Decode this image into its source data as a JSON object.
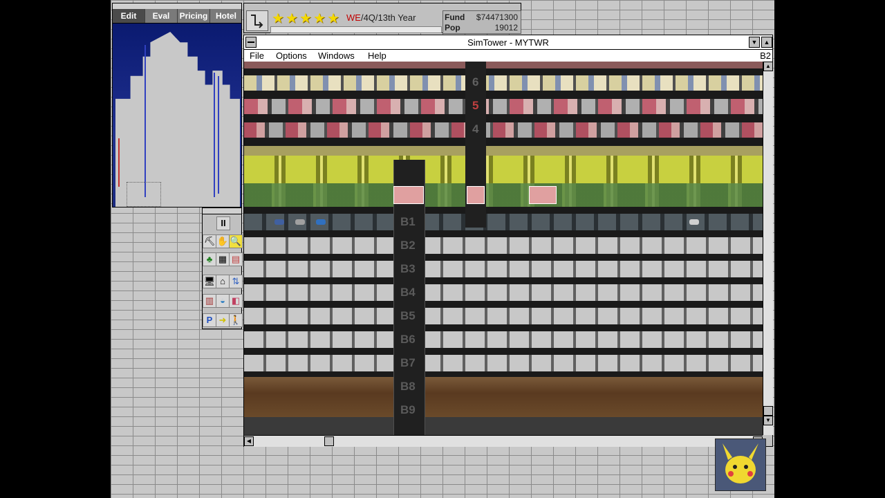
{
  "map": {
    "tabs": [
      "Edit",
      "Eval",
      "Pricing",
      "Hotel"
    ]
  },
  "status": {
    "stars": 5,
    "day": "WE",
    "date_rest": "/4Q/13th Year",
    "fund_label": "Fund",
    "fund_value": "$74471300",
    "pop_label": "Pop",
    "pop_value": "19012"
  },
  "window": {
    "title": "SimTower - MYTWR",
    "menus": [
      "File",
      "Options",
      "Windows",
      "Help"
    ],
    "current_floor": "B2"
  },
  "floors": {
    "upper": [
      "6",
      "5",
      "4"
    ],
    "basement": [
      "B1",
      "B2",
      "B3",
      "B4",
      "B5",
      "B6",
      "B7",
      "B8",
      "B9"
    ]
  },
  "tools": {
    "pause_label": "II",
    "parking_label": "P"
  },
  "colors": {
    "star": "#f4d800",
    "floor_number_red": "#c04040",
    "lobby_green": "#c8d040"
  }
}
